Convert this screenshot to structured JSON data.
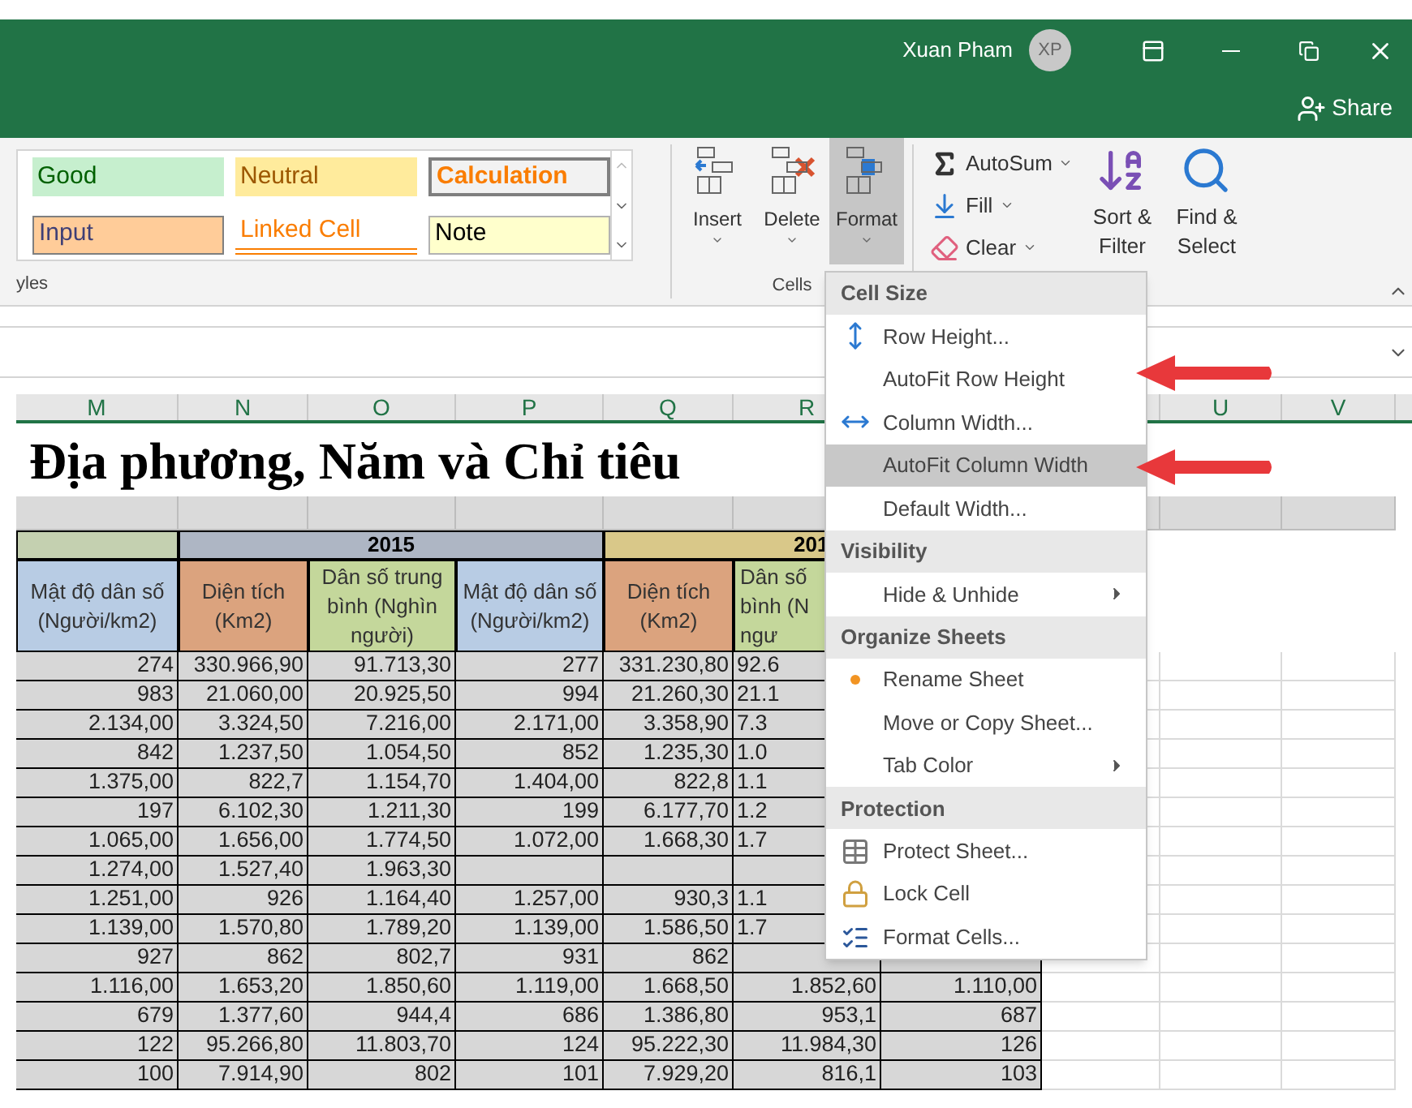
{
  "titlebar": {
    "user": "Xuan Pham",
    "avatar": "XP",
    "share": "Share"
  },
  "styles_gallery": {
    "items": [
      {
        "label": "Good",
        "kind": "good"
      },
      {
        "label": "Neutral",
        "kind": "neutral"
      },
      {
        "label": "Calculation",
        "kind": "calculation"
      },
      {
        "label": "Input",
        "kind": "input"
      },
      {
        "label": "Linked Cell",
        "kind": "linked"
      },
      {
        "label": "Note",
        "kind": "note"
      }
    ],
    "group_label": "yles"
  },
  "cells_group": {
    "buttons": [
      {
        "label": "Insert",
        "kind": "insert",
        "pressed": false
      },
      {
        "label": "Delete",
        "kind": "delete",
        "pressed": false
      },
      {
        "label": "Format",
        "kind": "format",
        "pressed": true
      }
    ],
    "group_label": "Cells"
  },
  "editing_group": {
    "small_buttons": [
      {
        "label": "AutoSum",
        "kind": "autosum"
      },
      {
        "label": "Fill",
        "kind": "fill"
      },
      {
        "label": "Clear",
        "kind": "clear"
      }
    ],
    "large_buttons": [
      {
        "line1": "Sort &",
        "line2": "Filter",
        "kind": "sort"
      },
      {
        "line1": "Find &",
        "line2": "Select",
        "kind": "find"
      }
    ]
  },
  "sheet": {
    "column_headers": [
      "M",
      "N",
      "O",
      "P",
      "Q",
      "R",
      "U",
      "V"
    ],
    "title": "Địa phương, Năm và Chỉ tiêu",
    "year_headers": [
      "2015",
      "201"
    ],
    "field_headers": [
      {
        "label": "Mật độ dân số (Người/km2)",
        "kind": "density"
      },
      {
        "label": "Diện tích (Km2)",
        "kind": "area"
      },
      {
        "label": "Dân số trung bình (Nghìn người)",
        "kind": "population"
      },
      {
        "label": "Mật độ dân số (Người/km2)",
        "kind": "density"
      },
      {
        "label": "Diện tích (Km2)",
        "kind": "area"
      },
      {
        "label": "Dân số\nbình (N\nngư",
        "kind": "population"
      }
    ],
    "rows": [
      [
        "274",
        "330.966,90",
        "91.713,30",
        "277",
        "331.230,80",
        "92.6"
      ],
      [
        "983",
        "21.060,00",
        "20.925,50",
        "994",
        "21.260,30",
        "21.1"
      ],
      [
        "2.134,00",
        "3.324,50",
        "7.216,00",
        "2.171,00",
        "3.358,90",
        "7.3"
      ],
      [
        "842",
        "1.237,50",
        "1.054,50",
        "852",
        "1.235,30",
        "1.0"
      ],
      [
        "1.375,00",
        "822,7",
        "1.154,70",
        "1.404,00",
        "822,8",
        "1.1"
      ],
      [
        "197",
        "6.102,30",
        "1.211,30",
        "199",
        "6.177,70",
        "1.2"
      ],
      [
        "1.065,00",
        "1.656,00",
        "1.774,50",
        "1.072,00",
        "1.668,30",
        "1.7"
      ],
      [
        "1.274,00",
        "1.527,40",
        "1.963,30"
      ],
      [
        "1.251,00",
        "926",
        "1.164,40",
        "1.257,00",
        "930,3",
        "1.1"
      ],
      [
        "1.139,00",
        "1.570,80",
        "1.789,20",
        "1.139,00",
        "1.586,50",
        "1.7"
      ],
      [
        "927",
        "862",
        "802,7",
        "931",
        "862"
      ],
      [
        "1.116,00",
        "1.653,20",
        "1.850,60",
        "1.119,00",
        "1.668,50",
        "1.852,60",
        "1.110,00"
      ],
      [
        "679",
        "1.377,60",
        "944,4",
        "686",
        "1.386,80",
        "953,1",
        "687"
      ],
      [
        "122",
        "95.266,80",
        "11.803,70",
        "124",
        "95.222,30",
        "11.984,30",
        "126"
      ],
      [
        "100",
        "7.914,90",
        "802",
        "101",
        "7.929,20",
        "816,1",
        "103"
      ]
    ]
  },
  "format_menu": {
    "sections": [
      {
        "heading": "Cell Size",
        "items": [
          {
            "label": "Row Height...",
            "kind": "row-height",
            "highlighted": false
          },
          {
            "label": "AutoFit Row Height",
            "highlighted": false
          },
          {
            "label": "Column Width...",
            "kind": "column-width",
            "highlighted": false
          },
          {
            "label": "AutoFit Column Width",
            "highlighted": true
          },
          {
            "label": "Default Width...",
            "highlighted": false
          }
        ]
      },
      {
        "heading": "Visibility",
        "items": [
          {
            "label": "Hide & Unhide",
            "submenu": true,
            "highlighted": false
          }
        ]
      },
      {
        "heading": "Organize Sheets",
        "items": [
          {
            "label": "Rename Sheet",
            "kind": "bullet",
            "highlighted": false
          },
          {
            "label": "Move or Copy Sheet...",
            "highlighted": false
          },
          {
            "label": "Tab Color",
            "submenu": true,
            "highlighted": false
          }
        ]
      },
      {
        "heading": "Protection",
        "items": [
          {
            "label": "Protect Sheet...",
            "kind": "protect",
            "highlighted": false
          },
          {
            "label": "Lock Cell",
            "kind": "lock",
            "highlighted": false
          },
          {
            "label": "Format Cells...",
            "kind": "format-cells",
            "highlighted": false
          }
        ]
      }
    ]
  }
}
